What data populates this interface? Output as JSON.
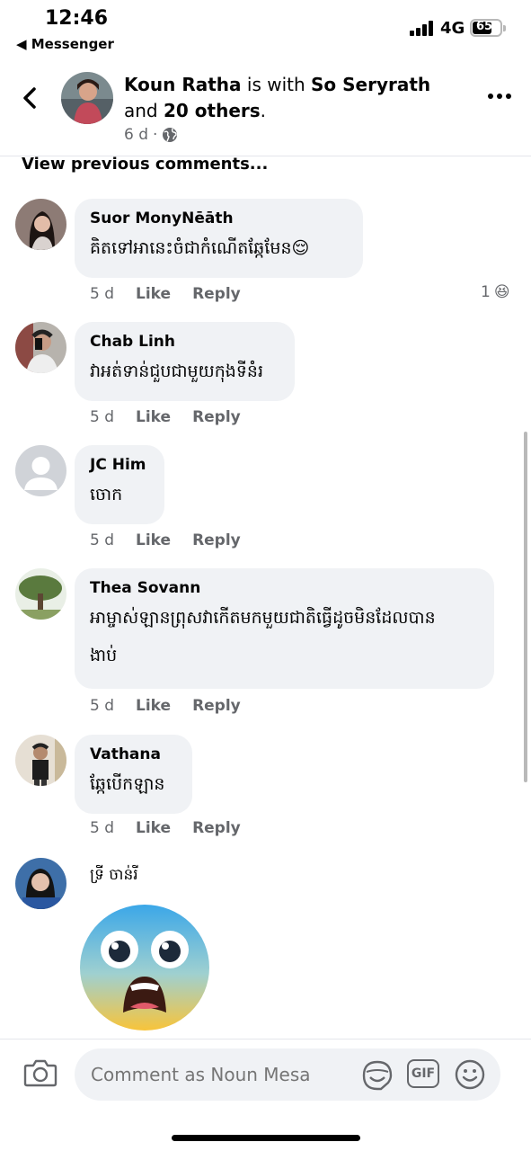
{
  "status_bar": {
    "time": "12:46",
    "back_app": "◀ Messenger",
    "network": "4G",
    "battery": "65"
  },
  "post": {
    "author": "Koun Ratha",
    "connector": " is with ",
    "tagged": "So Seryrath",
    "and_text": " and ",
    "others": "20 others",
    "period": ".",
    "age": "6 d",
    "separator": "·",
    "audience_icon": "globe-icon"
  },
  "view_previous": "View previous comments...",
  "comments": [
    {
      "name": "Suor MonyNēāth",
      "text": "គិតទៅអានេះចំជាកំណើតឆ្កែមែន",
      "emoji": "😌",
      "time": "5 d",
      "like": "Like",
      "reply": "Reply",
      "reaction_count": "1",
      "reaction_emoji": "😆"
    },
    {
      "name": "Chab Linh",
      "text": "វាអត់ទាន់ជួបជាមួយកុងទីនំរ",
      "time": "5 d",
      "like": "Like",
      "reply": "Reply"
    },
    {
      "name": "JC Him",
      "text": "ចោក",
      "time": "5 d",
      "like": "Like",
      "reply": "Reply"
    },
    {
      "name": "Thea Sovann",
      "text": "អាម្ចាស់ឡានព្រុសវាកើតមកមួយជាតិធ្វើដូចមិនដែលបាន",
      "text2": "ងាប់",
      "time": "5 d",
      "like": "Like",
      "reply": "Reply"
    },
    {
      "name": "Vathana",
      "text": "ឆ្កែបើកឡាន",
      "time": "5 d",
      "like": "Like",
      "reply": "Reply"
    },
    {
      "name": "ទ្រី ចាន់រី"
    }
  ],
  "composer": {
    "placeholder": "Comment as Noun Mesa",
    "gif_label": "GIF"
  },
  "colors": {
    "bubble": "#f0f2f5",
    "secondary_text": "#65676b",
    "primary_text": "#050505"
  }
}
